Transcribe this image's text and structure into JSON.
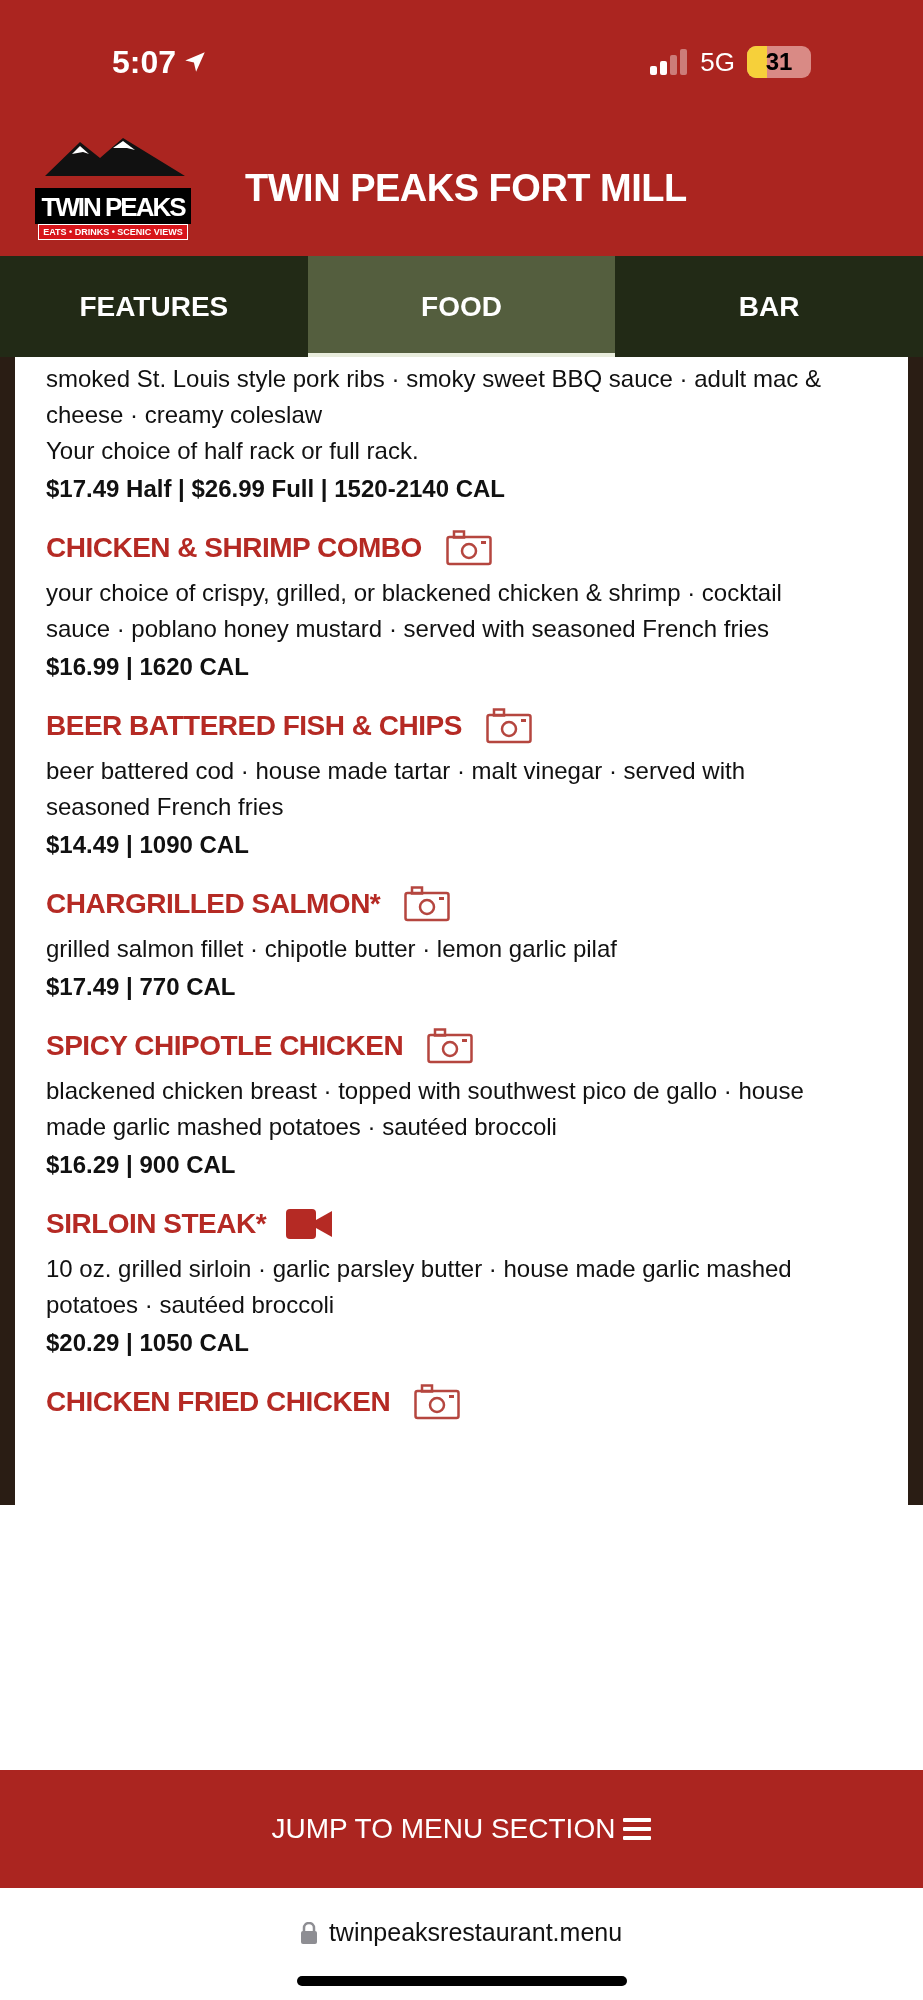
{
  "status_bar": {
    "time": "5:07",
    "network": "5G",
    "battery": "31"
  },
  "header": {
    "logo": {
      "name": "TWIN PEAKS",
      "tagline": "EATS • DRINKS • SCENIC VIEWS"
    },
    "title": "TWIN PEAKS FORT MILL"
  },
  "tabs": [
    {
      "label": "FEATURES",
      "selected": false
    },
    {
      "label": "FOOD",
      "selected": true
    },
    {
      "label": "BAR",
      "selected": false
    }
  ],
  "menu_items": [
    {
      "description": "smoked St. Louis style pork ribs · smoky sweet BBQ sauce · adult mac & cheese · creamy coleslaw",
      "note": "Your choice of half rack or full rack.",
      "price": "$17.49 Half | $26.99 Full | 1520-2140 CAL"
    },
    {
      "name": "CHICKEN & SHRIMP COMBO",
      "kind": "photo",
      "description": "your choice of crispy, grilled, or blackened chicken & shrimp · cocktail sauce · poblano honey mustard · served with seasoned French fries",
      "price": "$16.99 | 1620 CAL"
    },
    {
      "name": "BEER BATTERED FISH & CHIPS",
      "kind": "photo",
      "description": "beer battered cod · house made tartar · malt vinegar · served with seasoned French fries",
      "price": "$14.49 | 1090 CAL"
    },
    {
      "name": "CHARGRILLED SALMON*",
      "kind": "photo",
      "description": "grilled salmon fillet · chipotle butter · lemon garlic pilaf",
      "price": "$17.49 | 770 CAL"
    },
    {
      "name": "SPICY CHIPOTLE CHICKEN",
      "kind": "photo",
      "description": "blackened chicken breast · topped with southwest pico de gallo · house made garlic mashed potatoes · sautéed broccoli",
      "price": "$16.29 | 900 CAL"
    },
    {
      "name": "SIRLOIN STEAK*",
      "kind": "video",
      "description": "10 oz. grilled sirloin · garlic parsley butter · house made garlic mashed potatoes · sautéed broccoli",
      "price": "$20.29 | 1050 CAL"
    },
    {
      "name": "CHICKEN FRIED CHICKEN",
      "kind": "photo"
    }
  ],
  "jump_button": {
    "label": "JUMP TO MENU SECTION"
  },
  "browser": {
    "url": "twinpeaksrestaurant.menu"
  }
}
